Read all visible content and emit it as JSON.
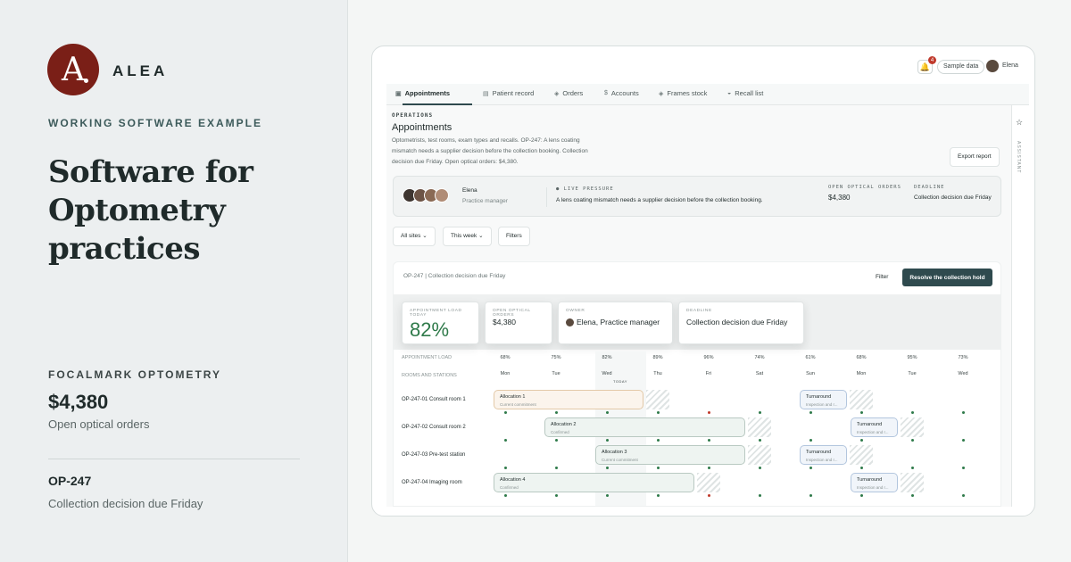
{
  "left": {
    "logo_letter": "A",
    "brand": "ALEA",
    "eyebrow": "WORKING SOFTWARE EXAMPLE",
    "headline": "Software for Optometry practices",
    "company": "FOCALMARK OPTOMETRY",
    "metric": "$4,380",
    "metric_label": "Open optical orders",
    "ref": "OP-247",
    "ref_label": "Collection decision due Friday"
  },
  "topbar": {
    "notification_count": "4",
    "sample_label": "Sample data",
    "user": "Elena"
  },
  "tabs": [
    {
      "label": "Appointments",
      "icon": "calendar-icon",
      "glyph": "▣"
    },
    {
      "label": "Patient record",
      "icon": "document-icon",
      "glyph": "▤"
    },
    {
      "label": "Orders",
      "icon": "box-icon",
      "glyph": "◈"
    },
    {
      "label": "Accounts",
      "icon": "dollar-icon",
      "glyph": "$"
    },
    {
      "label": "Frames stock",
      "icon": "box-icon",
      "glyph": "◈"
    },
    {
      "label": "Recall list",
      "icon": "inbox-icon",
      "glyph": "◒"
    }
  ],
  "page": {
    "section": "OPERATIONS",
    "title": "Appointments",
    "description": "Optometrists, test rooms, exam types and recalls. OP-247: A lens coating mismatch needs a supplier decision before the collection booking. Collection decision due Friday. Open optical orders: $4,380.",
    "export_label": "Export report"
  },
  "pressure": {
    "name": "Elena",
    "role": "Practice manager",
    "live_label": "● LIVE PRESSURE",
    "live_text": "A lens coating mismatch needs a supplier decision before the collection booking.",
    "orders_label": "OPEN OPTICAL ORDERS",
    "orders_value": "$4,380",
    "deadline_label": "DEADLINE",
    "deadline_value": "Collection decision due Friday"
  },
  "filters": {
    "sites": "All sites ⌄",
    "week": "This week ⌄",
    "filters": "Filters"
  },
  "board": {
    "title": "OP-247 | Collection decision due Friday",
    "filter_label": "Filter",
    "resolve_label": "Resolve the collection hold",
    "cards": [
      {
        "label": "APPOINTMENT LOAD TODAY",
        "value": "82%"
      },
      {
        "label": "OPEN OPTICAL ORDERS",
        "value": "$4,380"
      },
      {
        "label": "OWNER",
        "value": "Elena, Practice manager"
      },
      {
        "label": "DEADLINE",
        "value": "Collection decision due Friday"
      }
    ],
    "load_label": "APPOINTMENT LOAD",
    "rooms_label": "ROOMS AND STATIONS",
    "today_label": "TODAY",
    "days": [
      {
        "day": "Mon",
        "pct": "68%"
      },
      {
        "day": "Tue",
        "pct": "75%"
      },
      {
        "day": "Wed",
        "pct": "82%"
      },
      {
        "day": "Thu",
        "pct": "89%"
      },
      {
        "day": "Fri",
        "pct": "96%"
      },
      {
        "day": "Sat",
        "pct": "74%"
      },
      {
        "day": "Sun",
        "pct": "61%"
      },
      {
        "day": "Mon",
        "pct": "68%"
      },
      {
        "day": "Tue",
        "pct": "95%"
      },
      {
        "day": "Wed",
        "pct": "73%"
      }
    ],
    "rows": [
      {
        "name": "OP-247-01 Consult room 1",
        "bar": "Allocation 1",
        "bar_sub": "Current commitment",
        "turn": "Turnaround",
        "turn_sub": "Inspection and r..."
      },
      {
        "name": "OP-247-02 Consult room 2",
        "bar": "Allocation 2",
        "bar_sub": "Confirmed",
        "turn": "Turnaround",
        "turn_sub": "Inspection and r..."
      },
      {
        "name": "OP-247-03 Pre-test station",
        "bar": "Allocation 3",
        "bar_sub": "Current commitment",
        "turn": "Turnaround",
        "turn_sub": "Inspection and r..."
      },
      {
        "name": "OP-247-04 Imaging room",
        "bar": "Allocation 4",
        "bar_sub": "Confirmed",
        "turn": "Turnaround",
        "turn_sub": "Inspection and r..."
      }
    ]
  }
}
